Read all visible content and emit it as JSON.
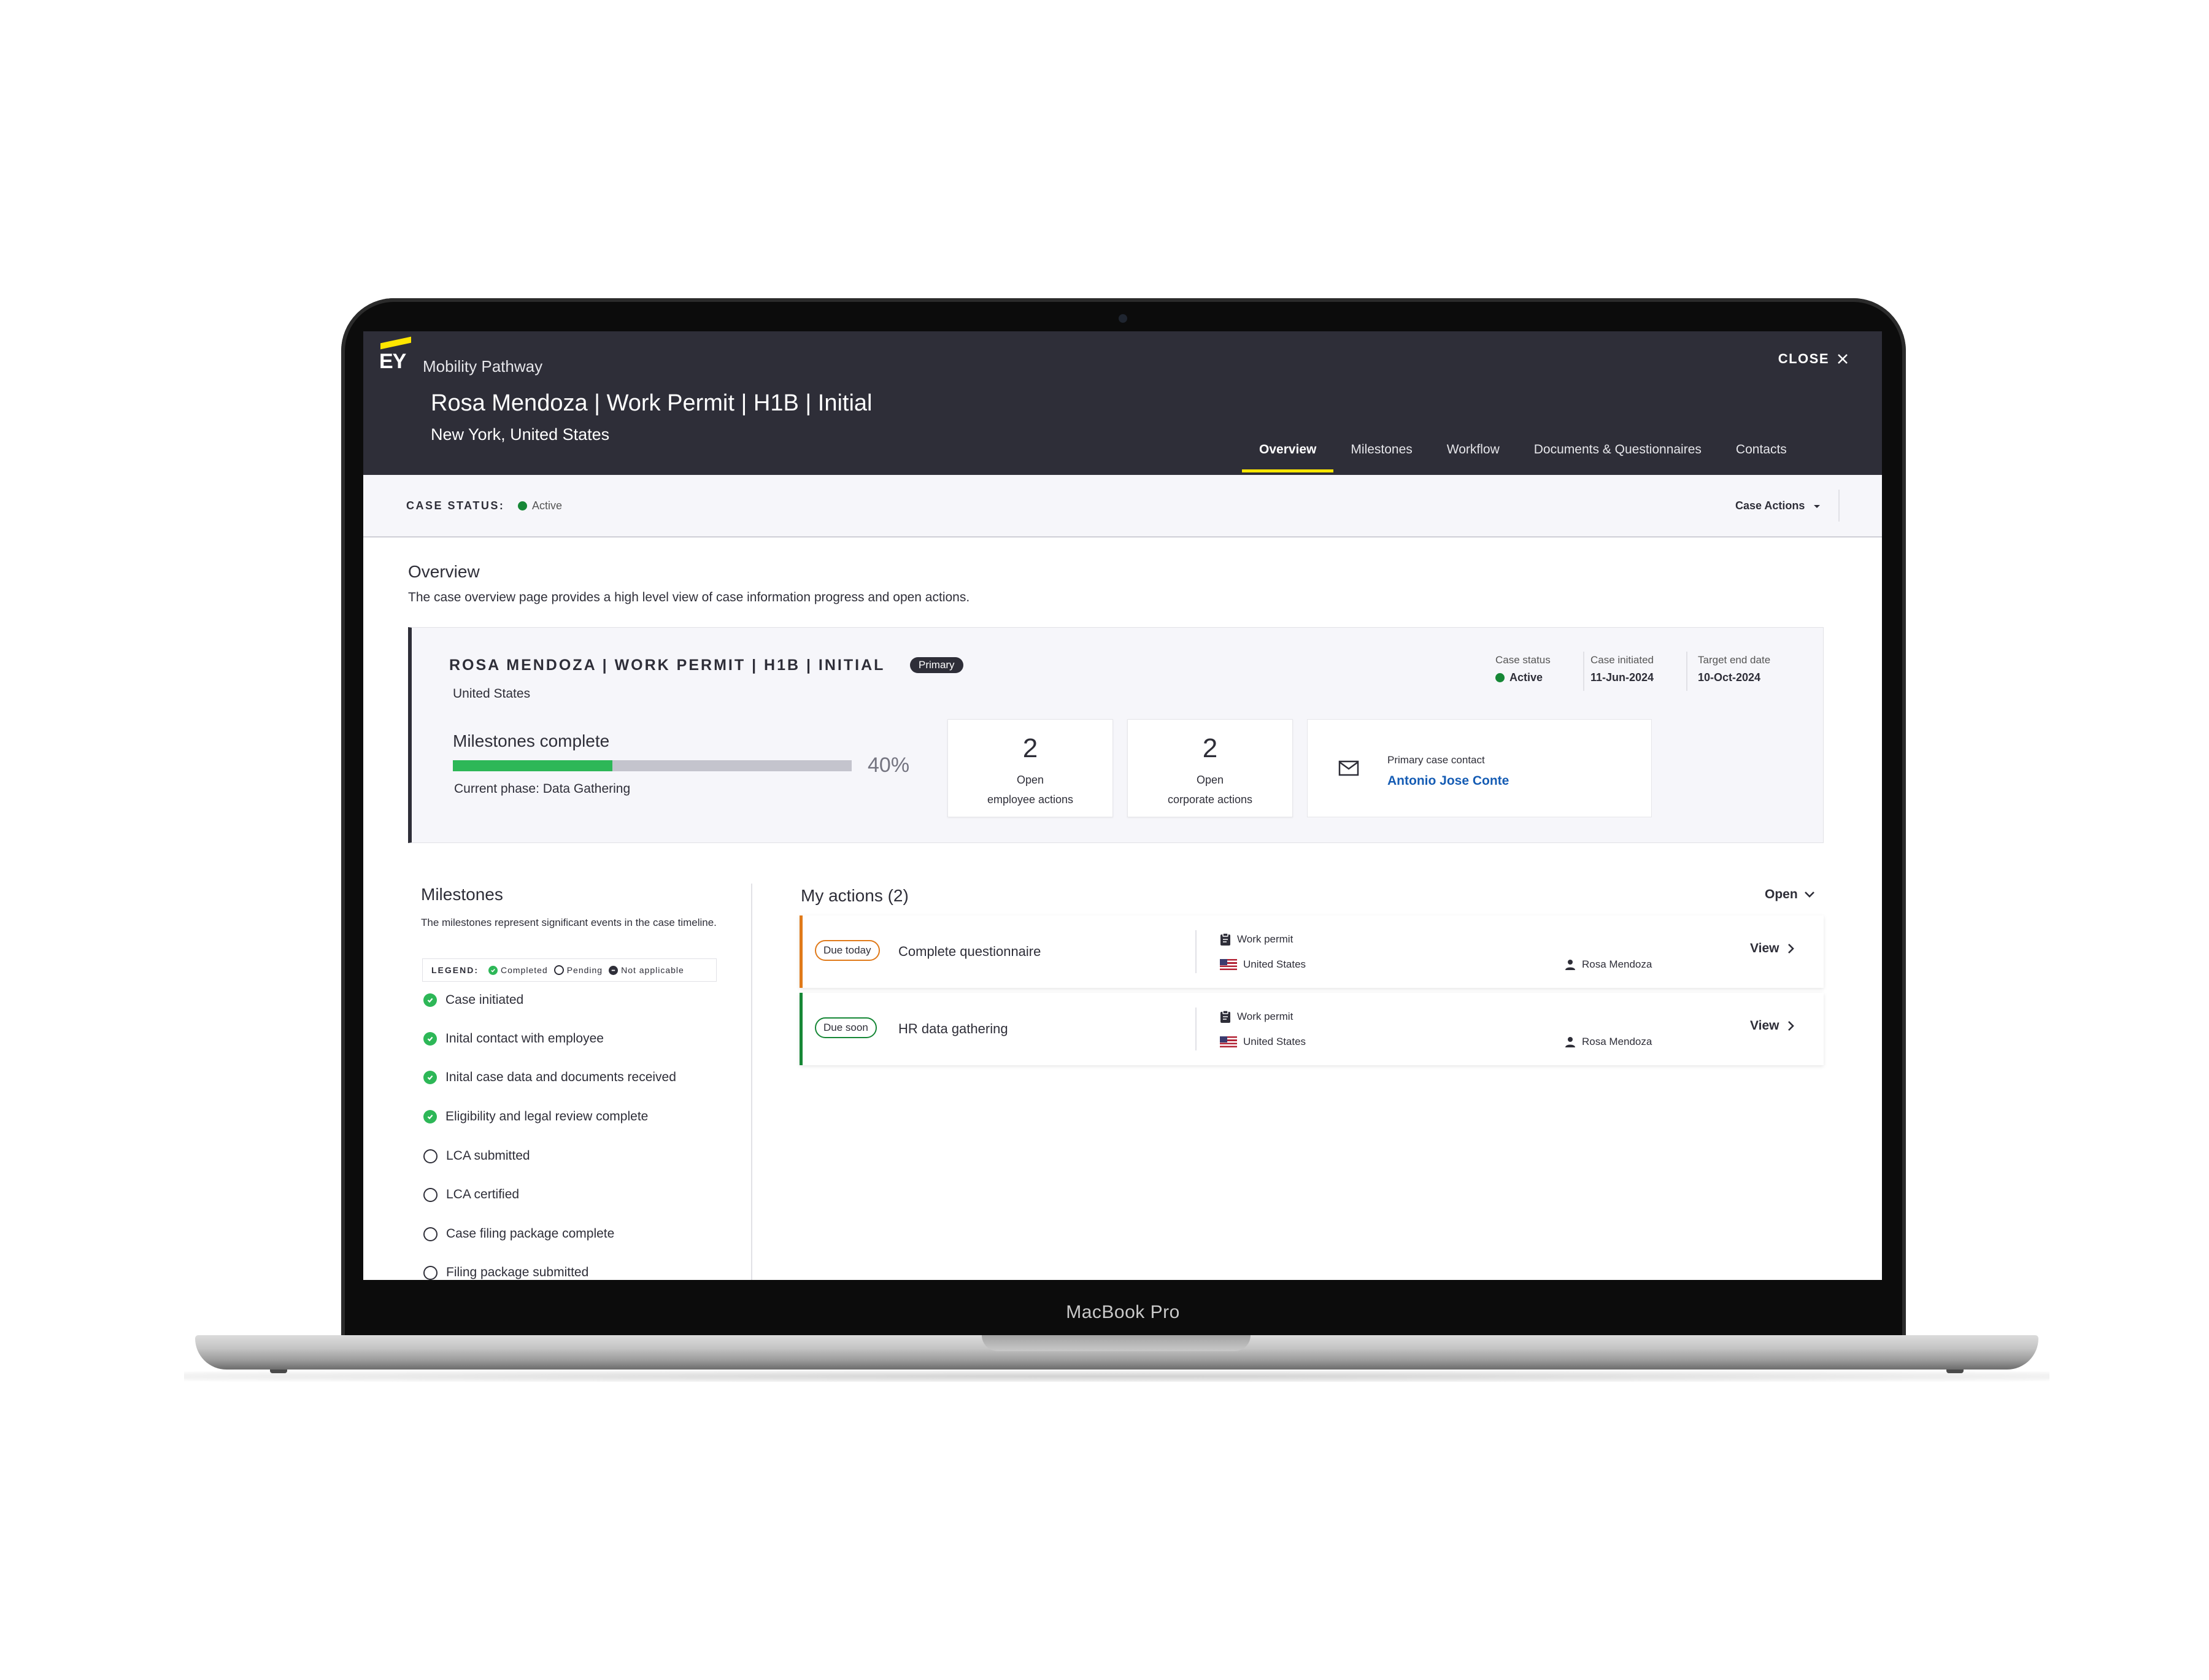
{
  "device": {
    "label": "MacBook Pro"
  },
  "app": {
    "logo": "EY",
    "name": "Mobility Pathway",
    "close_label": "CLOSE",
    "accent_color": "#ffe600",
    "header_bg": "#2e2e38"
  },
  "case": {
    "title": "Rosa Mendoza | Work Permit | H1B | Initial",
    "location": "New York, United States"
  },
  "tabs": [
    {
      "label": "Overview",
      "active": true
    },
    {
      "label": "Milestones",
      "active": false
    },
    {
      "label": "Workflow",
      "active": false
    },
    {
      "label": "Documents & Questionnaires",
      "active": false
    },
    {
      "label": "Contacts",
      "active": false
    }
  ],
  "statusbar": {
    "label": "CASE STATUS:",
    "value": "Active",
    "status_color": "#168736",
    "actions_label": "Case Actions"
  },
  "overview": {
    "title": "Overview",
    "description": "The case overview page provides a high level view of case information progress and open actions."
  },
  "case_card": {
    "title": "ROSA MENDOZA | WORK PERMIT | H1B  | INITIAL",
    "badge": "Primary",
    "country": "United States",
    "meta": [
      {
        "label": "Case status",
        "value": "Active"
      },
      {
        "label": "Case initiated",
        "value": "11-Jun-2024"
      },
      {
        "label": "Target end date",
        "value": "10-Oct-2024"
      }
    ],
    "milestones_label": "Milestones complete",
    "progress_percent": 40,
    "progress_text": "40%",
    "progress_color": "#2db757",
    "current_phase": "Current phase: Data Gathering",
    "stats": [
      {
        "number": "2",
        "line1": "Open",
        "line2": "employee actions"
      },
      {
        "number": "2",
        "line1": "Open",
        "line2": "corporate actions"
      }
    ],
    "contact": {
      "label": "Primary case contact",
      "name": "Antonio Jose Conte",
      "icon": "mail-icon"
    }
  },
  "milestones": {
    "title": "Milestones",
    "description": "The milestones represent significant events in the case timeline.",
    "legend": {
      "title": "LEGEND:",
      "completed": "Completed",
      "pending": "Pending",
      "not_applicable": "Not applicable"
    },
    "items": [
      {
        "label": "Case initiated",
        "state": "completed"
      },
      {
        "label": "Inital contact with employee",
        "state": "completed"
      },
      {
        "label": "Inital case data and documents received",
        "state": "completed"
      },
      {
        "label": "Eligibility and legal review complete",
        "state": "completed"
      },
      {
        "label": "LCA submitted",
        "state": "pending"
      },
      {
        "label": "LCA certified",
        "state": "pending"
      },
      {
        "label": "Case filing package complete",
        "state": "pending"
      },
      {
        "label": "Filing package submitted",
        "state": "pending"
      }
    ]
  },
  "actions": {
    "title": "My actions (2)",
    "filter": "Open",
    "items": [
      {
        "due": "Due today",
        "due_color": "#e07a1a",
        "name": "Complete questionnaire",
        "type": "Work permit",
        "country": "United States",
        "person": "Rosa  Mendoza",
        "view": "View"
      },
      {
        "due": "Due soon",
        "due_color": "#168736",
        "name": "HR data gathering",
        "type": "Work permit",
        "country": "United States",
        "person": "Rosa  Mendoza",
        "view": "View"
      }
    ]
  }
}
